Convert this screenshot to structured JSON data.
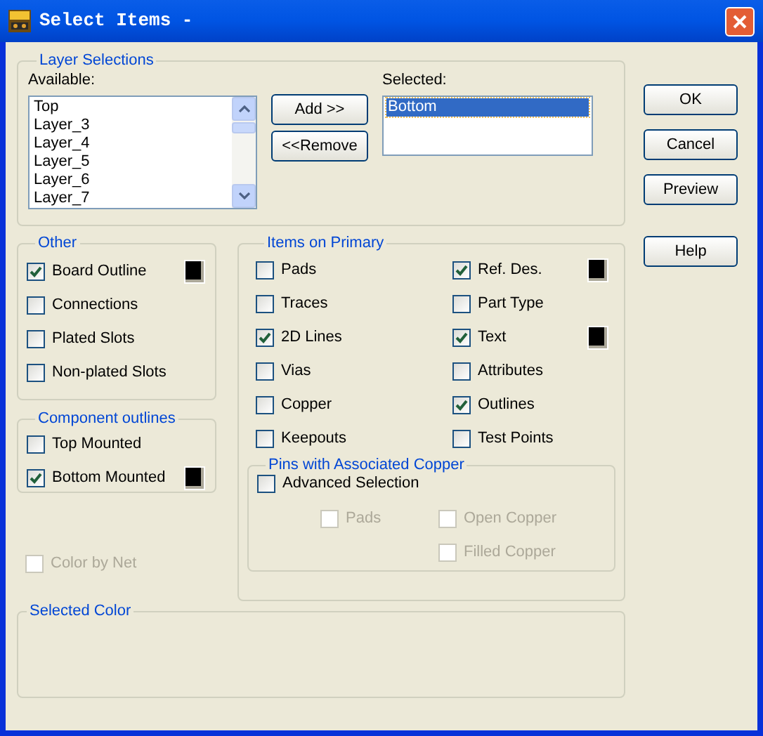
{
  "window": {
    "title": "Select Items -"
  },
  "layer_selections": {
    "title": "Layer Selections",
    "available_label": "Available:",
    "available": [
      {
        "label": "Top",
        "selected": false
      },
      {
        "label": "Layer_3",
        "selected": false
      },
      {
        "label": "Layer_4",
        "selected": false
      },
      {
        "label": "Layer_5",
        "selected": false
      },
      {
        "label": "Layer_6",
        "selected": false
      },
      {
        "label": "Layer_7",
        "selected": false
      }
    ],
    "move_buttons": [
      "Add >>",
      "<<Remove"
    ],
    "selected_label": "Selected:",
    "selected": [
      {
        "label": "Bottom",
        "selected": true
      }
    ]
  },
  "dialog_buttons": [
    "OK",
    "Cancel",
    "Preview",
    "Help"
  ],
  "other": {
    "title": "Other",
    "items": [
      {
        "label": "Board Outline",
        "checked": true,
        "color": "#000000"
      },
      {
        "label": "Connections",
        "checked": false
      },
      {
        "label": "Plated Slots",
        "checked": false
      },
      {
        "label": "Non-plated Slots",
        "checked": false
      }
    ]
  },
  "component_outlines": {
    "title": "Component outlines",
    "items": [
      {
        "label": "Top Mounted",
        "checked": false
      },
      {
        "label": "Bottom Mounted",
        "checked": true,
        "color": "#000000"
      }
    ]
  },
  "color_by_net": {
    "label": "Color by Net",
    "checked": false,
    "disabled": true
  },
  "items_on_primary": {
    "title": "Items on Primary",
    "items": [
      {
        "label": "Pads",
        "checked": false
      },
      {
        "label": "Ref. Des.",
        "checked": true,
        "color": "#000000"
      },
      {
        "label": "Traces",
        "checked": false
      },
      {
        "label": "Part Type",
        "checked": false
      },
      {
        "label": "2D Lines",
        "checked": true
      },
      {
        "label": "Text",
        "checked": true,
        "color": "#000000"
      },
      {
        "label": "Vias",
        "checked": false
      },
      {
        "label": "Attributes",
        "checked": false
      },
      {
        "label": "Copper",
        "checked": false
      },
      {
        "label": "Outlines",
        "checked": true
      },
      {
        "label": "Keepouts",
        "checked": false
      },
      {
        "label": "Test Points",
        "checked": false
      }
    ]
  },
  "pins_with_copper": {
    "title": "Pins with Associated Copper",
    "advanced": {
      "label": "Advanced Selection",
      "checked": false
    },
    "options": [
      {
        "label": "Pads",
        "checked": false,
        "disabled": true
      },
      {
        "label": "Open Copper",
        "checked": false,
        "disabled": true
      },
      {
        "label": "Filled Copper",
        "checked": false,
        "disabled": true
      }
    ]
  },
  "selected_color": {
    "title": "Selected Color"
  }
}
